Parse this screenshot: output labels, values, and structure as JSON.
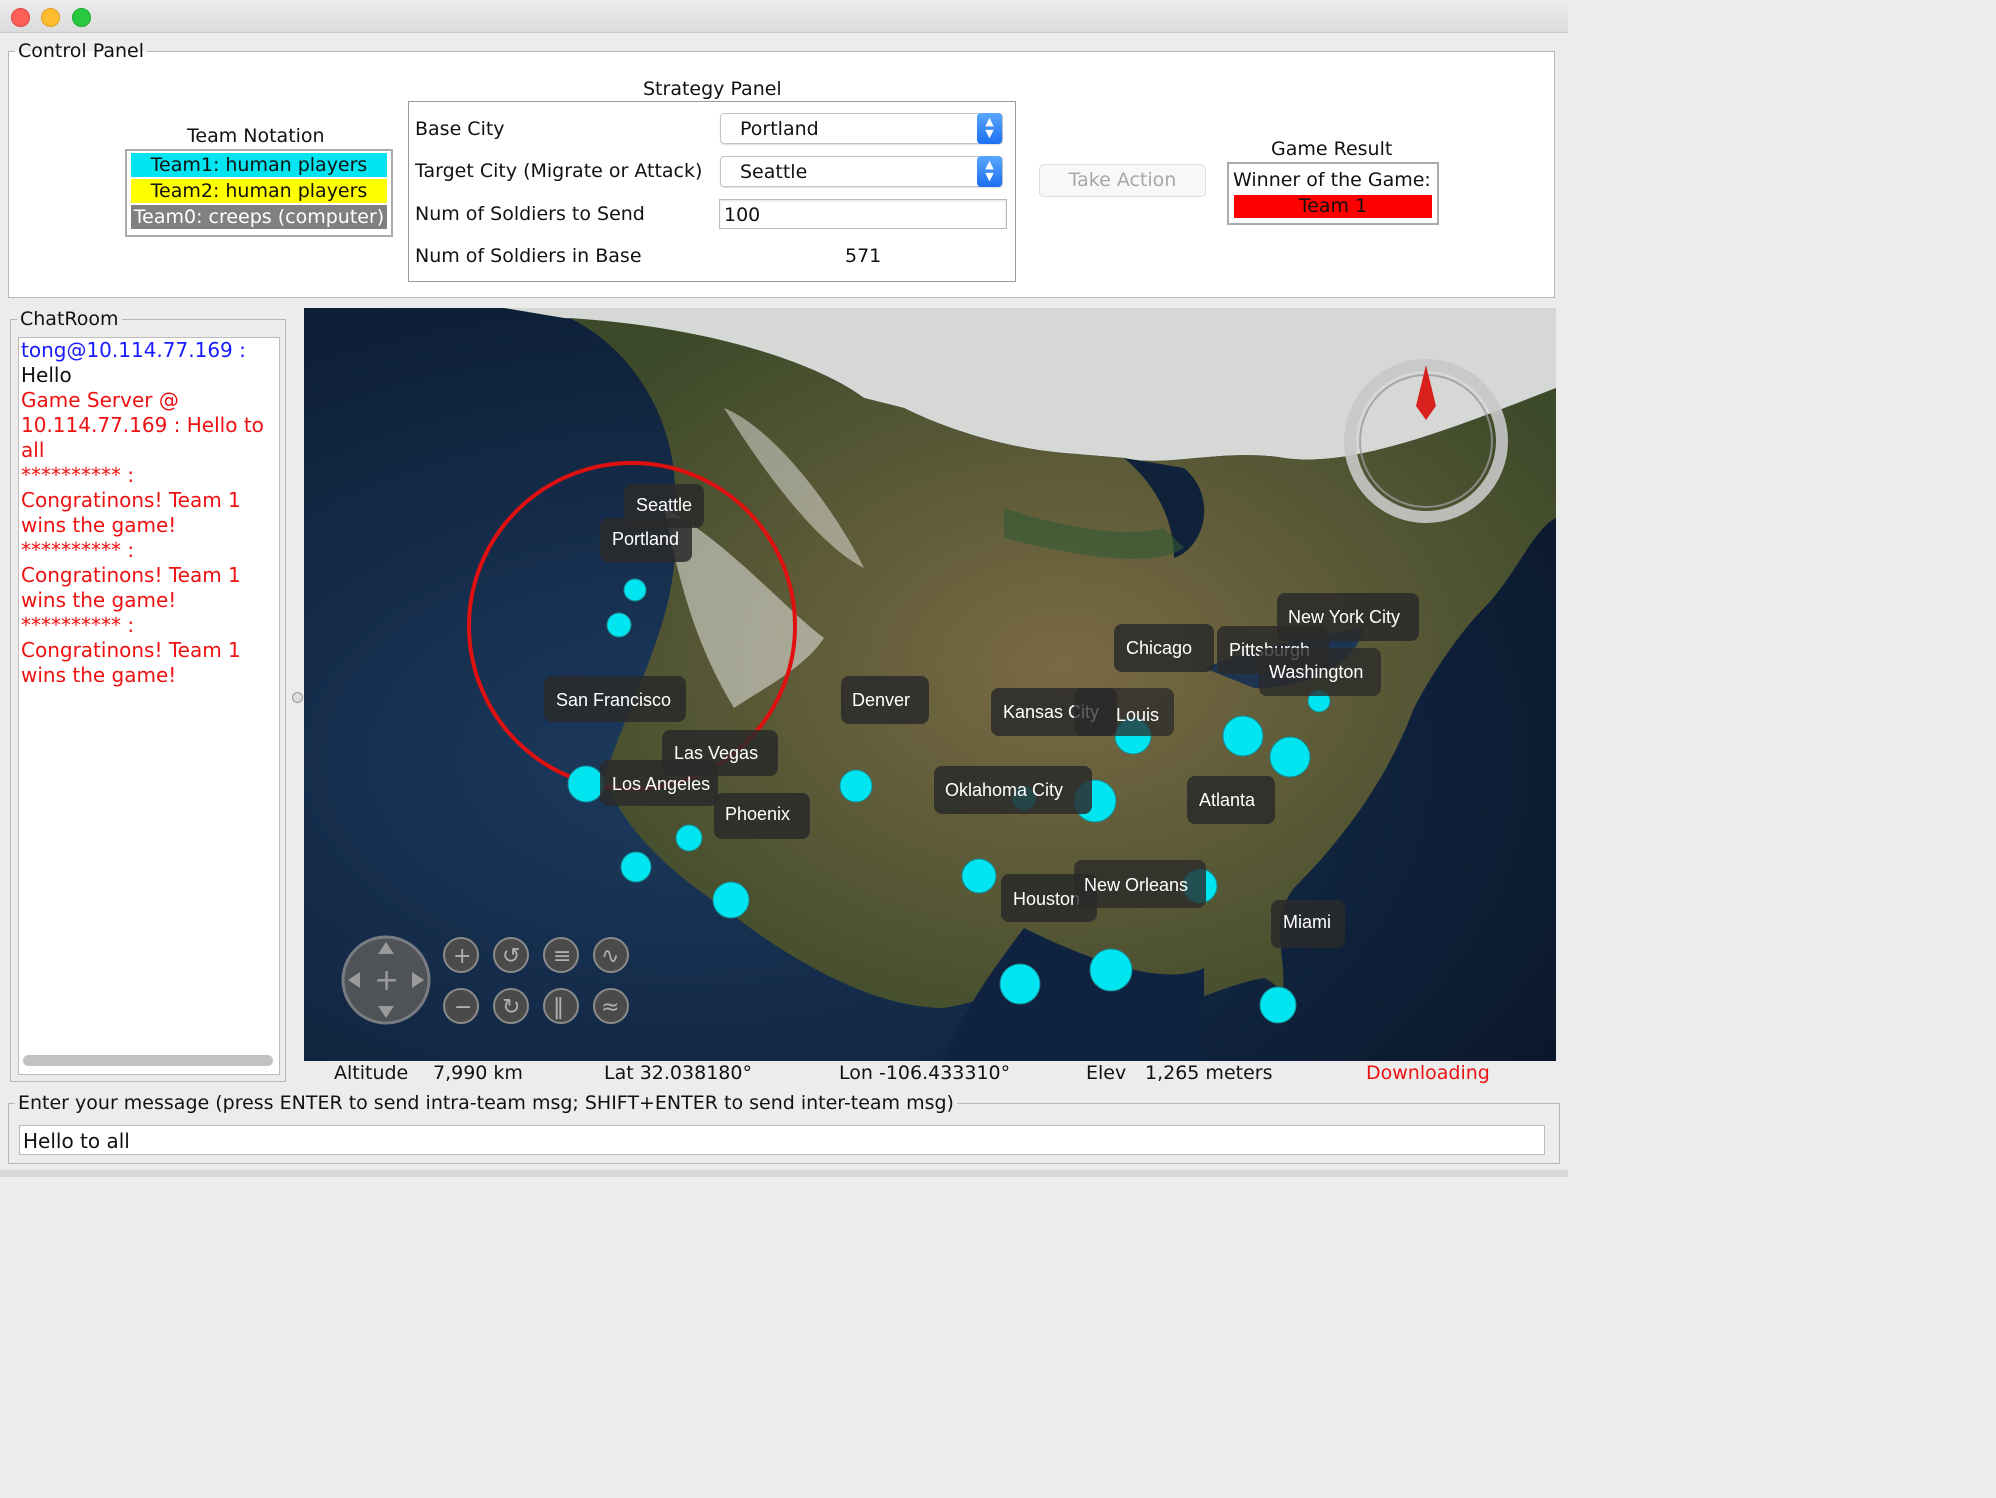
{
  "window": {
    "close": "close",
    "minimize": "minimize",
    "maximize": "maximize"
  },
  "control_panel": {
    "title": "Control Panel",
    "team_notation": {
      "title": "Team Notation",
      "team1": "Team1: human players",
      "team2": "Team2: human players",
      "team0": "Team0: creeps (computer)",
      "team1_color": "#00e5f0",
      "team2_color": "#ffff00",
      "team0_color": "#808080"
    },
    "strategy": {
      "title": "Strategy Panel",
      "base_city_label": "Base City",
      "base_city_value": "Portland",
      "target_city_label": "Target City (Migrate or Attack)",
      "target_city_value": "Seattle",
      "soldiers_send_label": "Num of Soldiers to Send",
      "soldiers_send_value": "100",
      "soldiers_base_label": "Num of Soldiers in Base",
      "soldiers_base_value": "571"
    },
    "take_action": "Take Action",
    "game_result": {
      "title": "Game Result",
      "winner_label": "Winner of the Game:",
      "winner_value": "Team 1",
      "winner_color": "#ff0000"
    }
  },
  "chatroom": {
    "title": "ChatRoom",
    "messages": [
      {
        "text": "tong@10.114.77.169 :",
        "color": "#1a1aff"
      },
      {
        "text": "Hello",
        "color": "#111111"
      },
      {
        "text": "Game Server @ 10.114.77.169 : Hello to all",
        "color": "#ee1111"
      },
      {
        "text": "********** : Congratinons! Team 1 wins the game!",
        "color": "#ee1111"
      },
      {
        "text": "********** : Congratinons! Team 1 wins the game!",
        "color": "#ee1111"
      },
      {
        "text": "********** : Congratinons! Team 1 wins the game!",
        "color": "#ee1111"
      }
    ]
  },
  "map": {
    "cities": [
      "Seattle",
      "Portland",
      "San Francisco",
      "Los Angeles",
      "Las Vegas",
      "Phoenix",
      "Denver",
      "Kansas City",
      "St. Louis",
      "Oklahoma City",
      "Chicago",
      "Pittsburgh",
      "Washington",
      "New York City",
      "Atlanta",
      "Houston",
      "New Orleans",
      "Miami"
    ],
    "city_color": "#00e5f0",
    "selection_color": "#e01010",
    "controls": [
      "pan-icon",
      "zoom-in-icon",
      "zoom-out-icon",
      "rotate-left-icon",
      "rotate-right-icon",
      "tilt-up-icon",
      "tilt-down-icon",
      "exaggerate-up-icon",
      "exaggerate-down-icon",
      "compass-icon"
    ],
    "status": {
      "altitude_label": "Altitude",
      "altitude_value": "7,990 km",
      "lat": "Lat 32.038180°",
      "lon": "Lon -106.433310°",
      "elev_label": "Elev",
      "elev_value": "1,265 meters",
      "downloading": "Downloading",
      "downloading_color": "#ee1111"
    }
  },
  "message": {
    "title": "Enter your message (press ENTER to send intra-team msg; SHIFT+ENTER to send inter-team msg)",
    "value": "Hello to all"
  }
}
